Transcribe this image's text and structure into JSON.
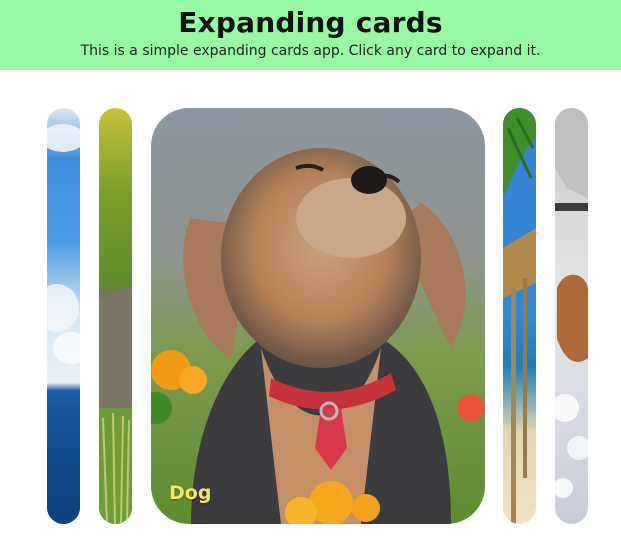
{
  "header": {
    "title": "Expanding cards",
    "subtitle": "This is a simple expanding cards app. Click any card to expand it."
  },
  "cards": [
    {
      "scene": "ocean-sky",
      "active": false
    },
    {
      "scene": "meadow",
      "active": false
    },
    {
      "scene": "dog",
      "active": true,
      "title": "Dog"
    },
    {
      "scene": "beach-palm",
      "active": false
    },
    {
      "scene": "splash",
      "active": false
    }
  ],
  "colors": {
    "header_bg": "#98f9a4",
    "title_accent": "#f3e46a"
  }
}
